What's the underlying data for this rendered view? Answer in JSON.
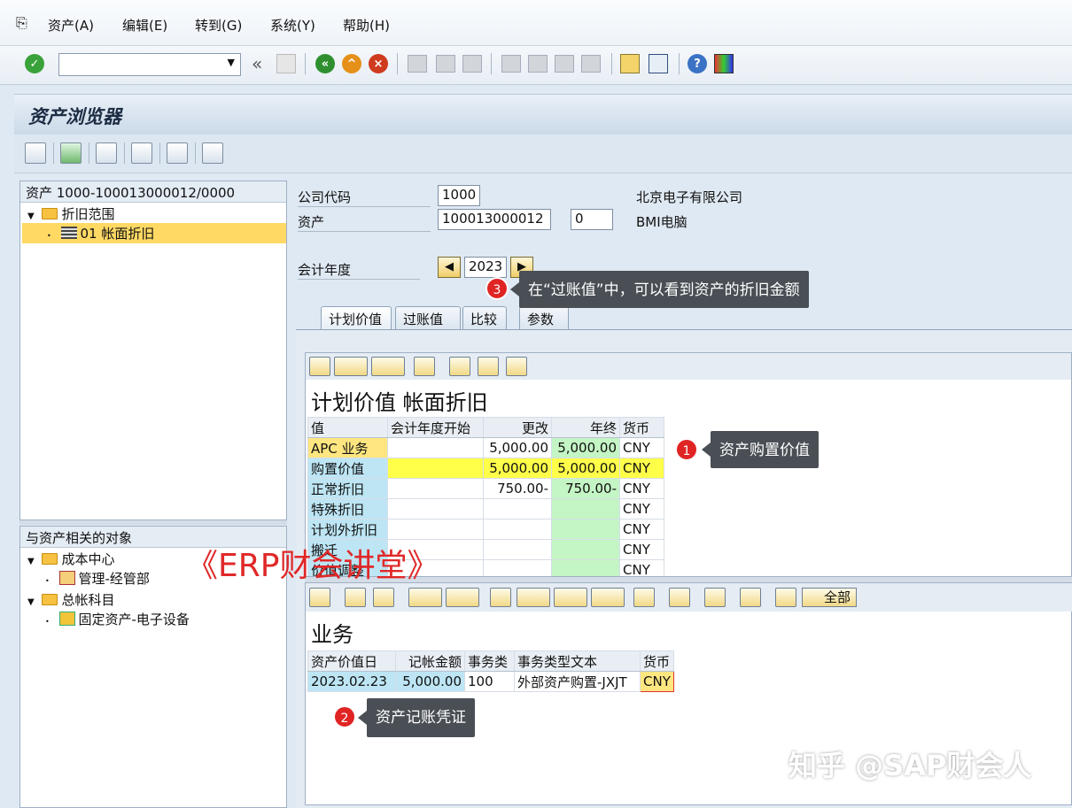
{
  "menu": [
    "资产(A)",
    "编辑(E)",
    "转到(G)",
    "系统(Y)",
    "帮助(H)"
  ],
  "toolbar": {
    "command_value": "",
    "back_label": "«"
  },
  "screen_title": "资产浏览器",
  "tree": {
    "header": "资产 1000-100013000012/0000",
    "depr_area_label": "折旧范围",
    "area_item": "01  帐面折旧"
  },
  "related": {
    "header": "与资产相关的对象",
    "cost_center_label": "成本中心",
    "cost_center_item": "管理-经管部",
    "gl_label": "总帐科目",
    "gl_item": "固定资产-电子设备"
  },
  "header_fields": {
    "company_code_label": "公司代码",
    "company_code": "1000",
    "company_name": "北京电子有限公司",
    "asset_label": "资产",
    "asset_number": "100013000012",
    "asset_sub": "0",
    "asset_name": "BMI电脑",
    "fiscal_year_label": "会计年度",
    "fiscal_year": "2023"
  },
  "tabs": [
    "计划价值",
    "过账值",
    "比较",
    "参数"
  ],
  "planned": {
    "title": "计划价值 帐面折旧",
    "columns": [
      "值",
      "会计年度开始",
      "更改",
      "年终",
      "货币"
    ],
    "rows": [
      [
        "APC 业务",
        "",
        "5,000.00",
        "5,000.00",
        "CNY"
      ],
      [
        "购置价值",
        "",
        "5,000.00",
        "5,000.00",
        "CNY"
      ],
      [
        "正常折旧",
        "",
        "750.00-",
        "750.00-",
        "CNY"
      ],
      [
        "特殊折旧",
        "",
        "",
        "",
        "CNY"
      ],
      [
        "计划外折旧",
        "",
        "",
        "",
        "CNY"
      ],
      [
        "搬迁",
        "",
        "",
        "",
        "CNY"
      ],
      [
        "价值调整",
        "",
        "",
        "",
        "CNY"
      ]
    ]
  },
  "transactions": {
    "title": "业务",
    "all_label": "全部",
    "columns": [
      "资产价值日",
      "记帐金额",
      "事务类",
      "事务类型文本",
      "货币"
    ],
    "rows": [
      [
        "2023.02.23",
        "5,000.00",
        "100",
        "外部资产购置-JXJT",
        "CNY"
      ]
    ]
  },
  "annotations": [
    {
      "num": "1",
      "text": "资产购置价值"
    },
    {
      "num": "2",
      "text": "资产记账凭证"
    },
    {
      "num": "3",
      "text": "在“过账值”中，可以看到资产的折旧金额"
    }
  ],
  "watermarks": {
    "erp": "《ERP财会讲堂》",
    "zhihu": "知乎 @SAP财会人"
  },
  "colors": {
    "accent_blue": "#bde5f4",
    "highlight_yellow": "#ffff4a",
    "green": "#c4f5c4",
    "callout": "#4a4f55",
    "badge_red": "#e02424"
  }
}
